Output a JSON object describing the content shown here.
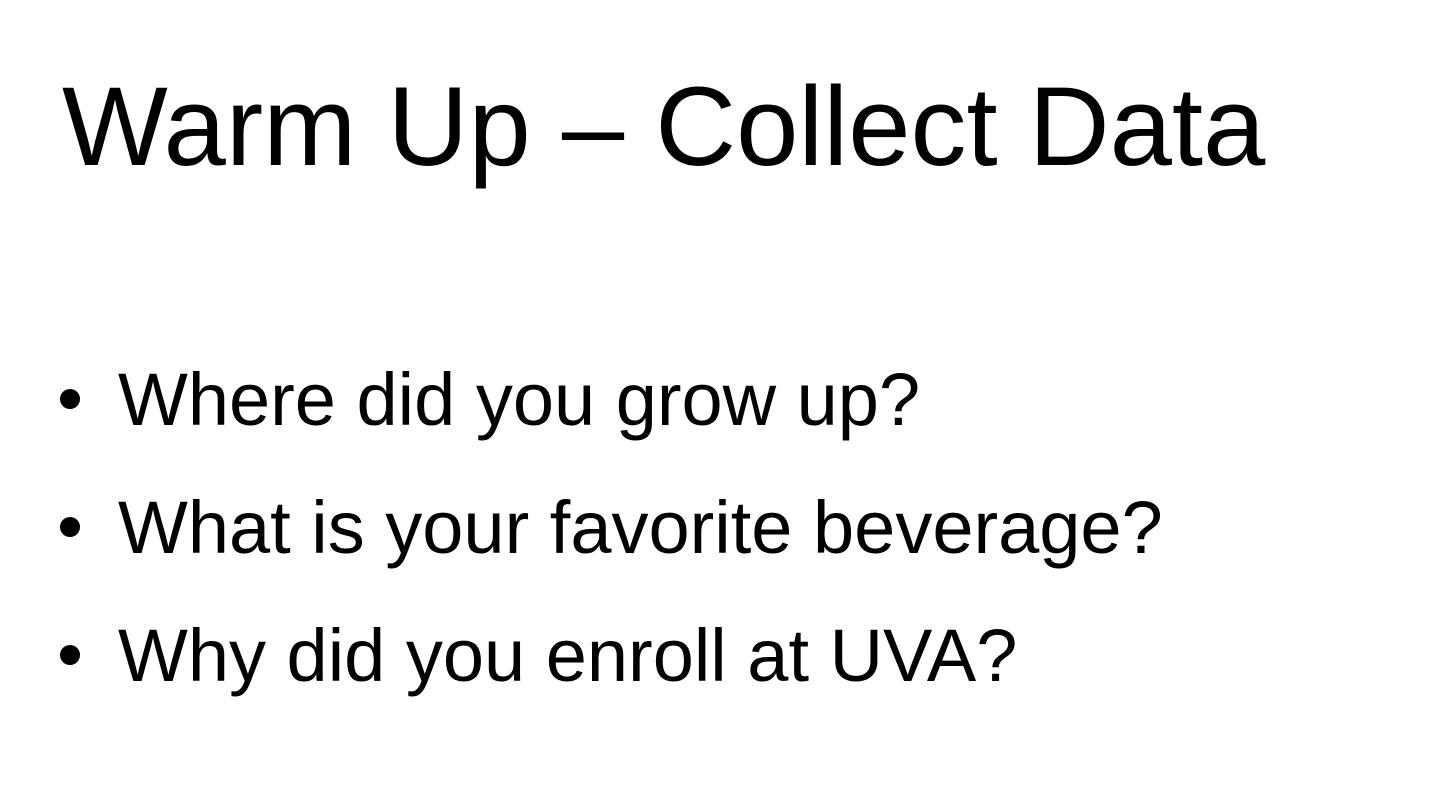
{
  "slide": {
    "title": "Warm Up – Collect Data",
    "bullets": [
      "Where did you grow up?",
      "What is your favorite beverage?",
      "Why did you enroll at UVA?"
    ],
    "bullet_icon": "bullet-dot-icon",
    "colors": {
      "background": "#ffffff",
      "text": "#000000"
    }
  }
}
